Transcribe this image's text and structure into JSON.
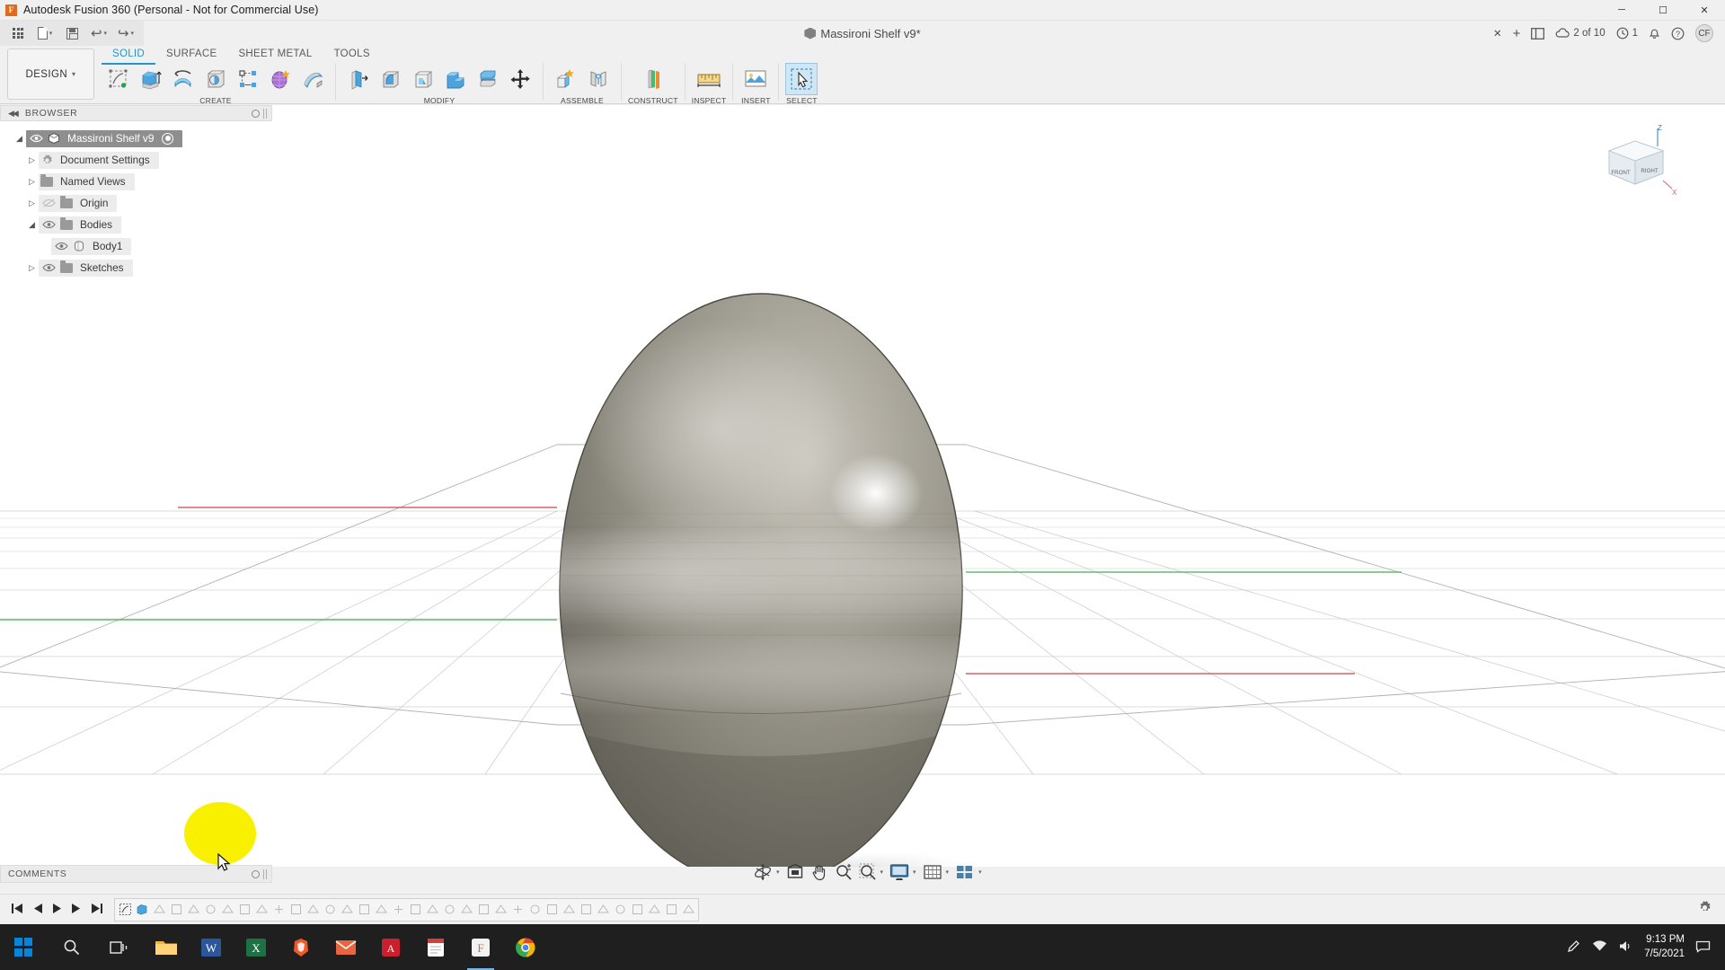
{
  "titlebar": {
    "app_name": "Autodesk Fusion 360 (Personal - Not for Commercial Use)",
    "logo_letter": "F",
    "minimize": "─",
    "maximize": "☐",
    "close": "✕"
  },
  "quick_access": {
    "grid_icon": "app-grid-icon",
    "new_icon": "new-document-icon",
    "save_icon": "save-icon",
    "undo_icon": "undo-icon",
    "redo_icon": "redo-icon",
    "document_title": "Massironi Shelf v9*",
    "tab_close": "✕",
    "add_tab": "+",
    "panel_icon": "data-panel-icon",
    "job_count": "2 of 10",
    "history_count": "1",
    "bell_icon": "notifications-icon",
    "help_icon": "?",
    "user_initials": "CF"
  },
  "workspace": {
    "label": "DESIGN",
    "caret": "▾"
  },
  "ribbon_tabs": [
    {
      "label": "SOLID",
      "active": true
    },
    {
      "label": "SURFACE",
      "active": false
    },
    {
      "label": "SHEET METAL",
      "active": false
    },
    {
      "label": "TOOLS",
      "active": false
    }
  ],
  "ribbon_groups": [
    {
      "label": "CREATE",
      "tools": [
        "create-sketch-icon",
        "extrude-icon",
        "revolve-icon",
        "sweep-icon",
        "pattern-icon",
        "form-icon",
        "sheet-metal-flange-icon"
      ]
    },
    {
      "label": "MODIFY",
      "tools": [
        "press-pull-icon",
        "fillet-icon",
        "shell-icon",
        "combine-icon",
        "offset-face-icon",
        "move-copy-icon"
      ]
    },
    {
      "label": "ASSEMBLE",
      "tools": [
        "new-component-icon",
        "joint-icon"
      ]
    },
    {
      "label": "CONSTRUCT",
      "tools": [
        "offset-plane-icon"
      ]
    },
    {
      "label": "INSPECT",
      "tools": [
        "measure-icon"
      ]
    },
    {
      "label": "INSERT",
      "tools": [
        "insert-mcmaster-icon"
      ]
    },
    {
      "label": "SELECT",
      "tools": [
        "select-cursor-icon"
      ]
    }
  ],
  "browser": {
    "header": "BROWSER",
    "collapse_icon": "collapse-left-icon",
    "tree": [
      {
        "label": "Massironi Shelf v9",
        "indent": 0,
        "triangle": "◢",
        "eye": true,
        "icon": "component-cube-icon",
        "selected": true,
        "radio": true
      },
      {
        "label": "Document Settings",
        "indent": 1,
        "triangle": "▷",
        "eye": false,
        "icon": "gear-icon",
        "selected": false,
        "radio": false
      },
      {
        "label": "Named Views",
        "indent": 1,
        "triangle": "▷",
        "eye": false,
        "icon": "folder-icon",
        "selected": false,
        "radio": false
      },
      {
        "label": "Origin",
        "indent": 1,
        "triangle": "▷",
        "eye": true,
        "eye_off": true,
        "icon": "folder-icon",
        "selected": false,
        "radio": false
      },
      {
        "label": "Bodies",
        "indent": 1,
        "triangle": "◢",
        "eye": true,
        "icon": "folder-icon",
        "selected": false,
        "radio": false
      },
      {
        "label": "Body1",
        "indent": 2,
        "triangle": "",
        "eye": true,
        "icon": "body-icon",
        "selected": false,
        "radio": false
      },
      {
        "label": "Sketches",
        "indent": 1,
        "triangle": "▷",
        "eye": true,
        "icon": "folder-icon",
        "selected": false,
        "radio": false
      }
    ]
  },
  "viewcube": {
    "top_axis": "Z",
    "bottom_axis": "X",
    "front_face": "FRONT",
    "right_face": "RIGHT"
  },
  "comments": {
    "label": "COMMENTS"
  },
  "navbar": [
    {
      "name": "orbit-icon",
      "caret": true
    },
    {
      "name": "look-at-icon",
      "caret": false
    },
    {
      "name": "pan-hand-icon",
      "caret": false
    },
    {
      "name": "zoom-icon",
      "caret": false
    },
    {
      "name": "zoom-window-icon",
      "caret": true
    },
    {
      "name": "display-settings-icon",
      "caret": true
    },
    {
      "name": "grid-snap-icon",
      "caret": true
    },
    {
      "name": "viewports-icon",
      "caret": true
    }
  ],
  "timeline": {
    "playback": [
      "skip-start-icon",
      "step-back-icon",
      "play-icon",
      "step-forward-icon",
      "skip-end-icon"
    ],
    "feature_count": 33
  },
  "taskbar": {
    "start_icon": "windows-start-icon",
    "search_icon": "search-icon",
    "taskview_icon": "task-view-icon",
    "apps": [
      {
        "name": "file-explorer-icon",
        "color": "#f5b33c",
        "active": false
      },
      {
        "name": "word-icon",
        "color": "#2b579a",
        "active": false
      },
      {
        "name": "excel-icon",
        "color": "#1e7145",
        "active": false
      },
      {
        "name": "brave-icon",
        "color": "#f05a28",
        "active": false
      },
      {
        "name": "mail-icon",
        "color": "#e8663d",
        "active": false
      },
      {
        "name": "acrobat-icon",
        "color": "#c8202e",
        "active": false
      },
      {
        "name": "notes-icon",
        "color": "#d63e3e",
        "active": false
      },
      {
        "name": "fusion360-icon",
        "color": "#e06b1f",
        "active": true
      },
      {
        "name": "chrome-icon",
        "color": "#4285f4",
        "active": false
      }
    ],
    "tray": [
      "pen-icon",
      "network-icon",
      "volume-icon"
    ],
    "time": "9:13 PM",
    "date": "7/5/2021",
    "action_center": "notification-icon"
  }
}
